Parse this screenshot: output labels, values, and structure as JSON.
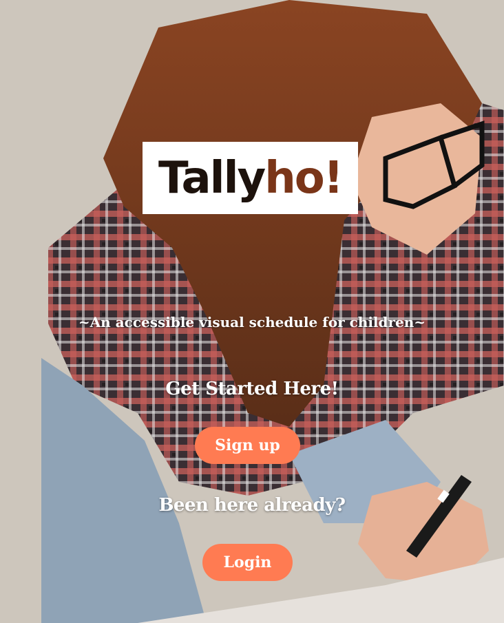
{
  "logo": {
    "main": "Tally",
    "accent": "ho!"
  },
  "tagline": "~An accessible visual schedule for children~",
  "get_started": {
    "heading": "Get Started Here!",
    "button_label": "Sign up"
  },
  "returning": {
    "heading": "Been here already?",
    "button_label": "Login"
  },
  "colors": {
    "button": "#ff7b52",
    "text": "#ffffff",
    "logo_dark": "#1d120c",
    "logo_accent": "#7a3518"
  }
}
